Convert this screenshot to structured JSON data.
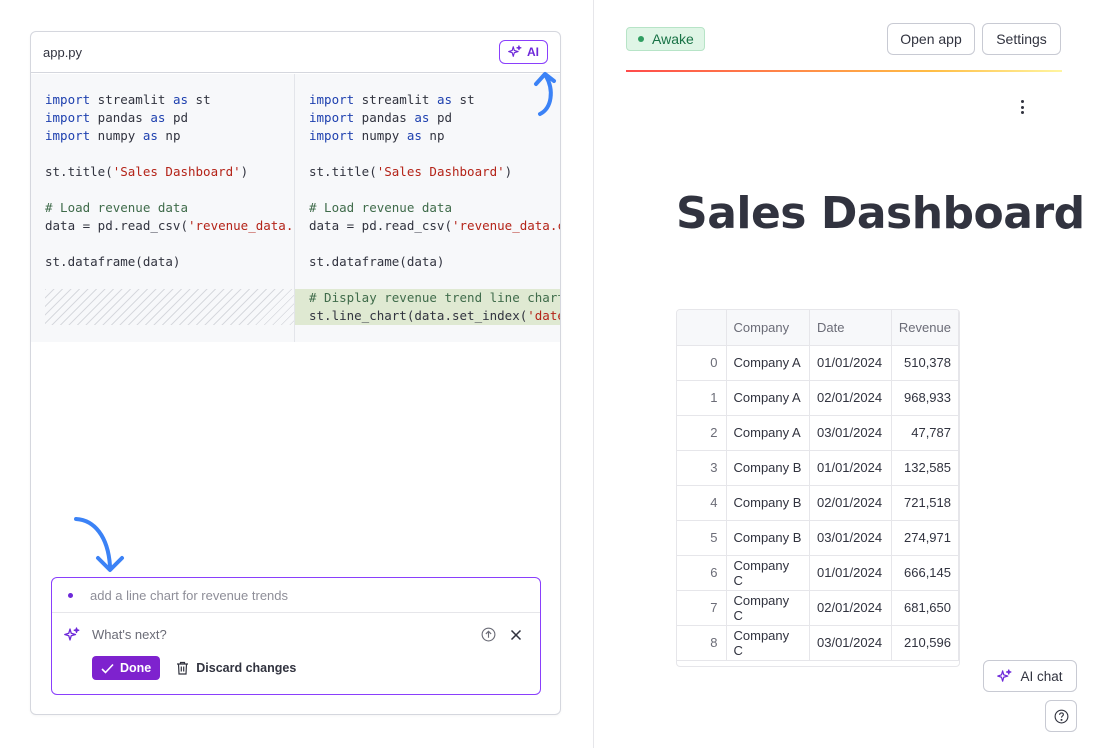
{
  "editor": {
    "filename": "app.py",
    "ai_button_label": "AI"
  },
  "code": {
    "original_lines": [
      [
        {
          "t": "import",
          "c": "kw"
        },
        {
          "t": " streamlit "
        },
        {
          "t": "as",
          "c": "kw"
        },
        {
          "t": " st"
        }
      ],
      [
        {
          "t": "import",
          "c": "kw"
        },
        {
          "t": " pandas "
        },
        {
          "t": "as",
          "c": "kw"
        },
        {
          "t": " pd"
        }
      ],
      [
        {
          "t": "import",
          "c": "kw"
        },
        {
          "t": " numpy "
        },
        {
          "t": "as",
          "c": "kw"
        },
        {
          "t": " np"
        }
      ],
      [],
      [
        {
          "t": "st.title("
        },
        {
          "t": "'Sales Dashboard'",
          "c": "str"
        },
        {
          "t": ")"
        }
      ],
      [],
      [
        {
          "t": "# Load revenue data",
          "c": "cmt"
        }
      ],
      [
        {
          "t": "data = pd.read_csv("
        },
        {
          "t": "'revenue_data.csv'",
          "c": "str"
        },
        {
          "t": ")"
        }
      ],
      [],
      [
        {
          "t": "st.dataframe(data)"
        }
      ]
    ],
    "modified_lines": [
      [
        {
          "t": "import",
          "c": "kw"
        },
        {
          "t": " streamlit "
        },
        {
          "t": "as",
          "c": "kw"
        },
        {
          "t": " st"
        }
      ],
      [
        {
          "t": "import",
          "c": "kw"
        },
        {
          "t": " pandas "
        },
        {
          "t": "as",
          "c": "kw"
        },
        {
          "t": " pd"
        }
      ],
      [
        {
          "t": "import",
          "c": "kw"
        },
        {
          "t": " numpy "
        },
        {
          "t": "as",
          "c": "kw"
        },
        {
          "t": " np"
        }
      ],
      [],
      [
        {
          "t": "st.title("
        },
        {
          "t": "'Sales Dashboard'",
          "c": "str"
        },
        {
          "t": ")"
        }
      ],
      [],
      [
        {
          "t": "# Load revenue data",
          "c": "cmt"
        }
      ],
      [
        {
          "t": "data = pd.read_csv("
        },
        {
          "t": "'revenue_data.csv'",
          "c": "str"
        },
        {
          "t": ")"
        }
      ],
      [],
      [
        {
          "t": "st.dataframe(data)"
        }
      ],
      [],
      [
        {
          "t": "# Display revenue trend line chart",
          "c": "cmt",
          "added": true
        }
      ],
      [
        {
          "t": "st.line_chart(data.set_index(",
          "added": true
        },
        {
          "t": "'date'",
          "c": "str",
          "added": true
        },
        {
          "t": "))",
          "added": true
        }
      ]
    ]
  },
  "prompt": {
    "history_item": "add a line chart for revenue trends",
    "placeholder": "What's next?",
    "done_label": "Done",
    "discard_label": "Discard changes"
  },
  "header": {
    "status": "Awake",
    "open_app_label": "Open app",
    "settings_label": "Settings"
  },
  "app": {
    "title": "Sales Dashboard",
    "table": {
      "columns": [
        "",
        "Company",
        "Date",
        "Revenue"
      ],
      "rows": [
        [
          "0",
          "Company A",
          "01/01/2024",
          "510,378"
        ],
        [
          "1",
          "Company A",
          "02/01/2024",
          "968,933"
        ],
        [
          "2",
          "Company A",
          "03/01/2024",
          "47,787"
        ],
        [
          "3",
          "Company B",
          "01/01/2024",
          "132,585"
        ],
        [
          "4",
          "Company B",
          "02/01/2024",
          "721,518"
        ],
        [
          "5",
          "Company B",
          "03/01/2024",
          "274,971"
        ],
        [
          "6",
          "Company C",
          "01/01/2024",
          "666,145"
        ],
        [
          "7",
          "Company C",
          "02/01/2024",
          "681,650"
        ],
        [
          "8",
          "Company C",
          "03/01/2024",
          "210,596"
        ]
      ]
    }
  },
  "footer": {
    "ai_chat_label": "AI chat"
  },
  "colors": {
    "accent_purple": "#7e22ce",
    "annotation_arrow": "#3b82f6",
    "status_green": "#177245"
  }
}
